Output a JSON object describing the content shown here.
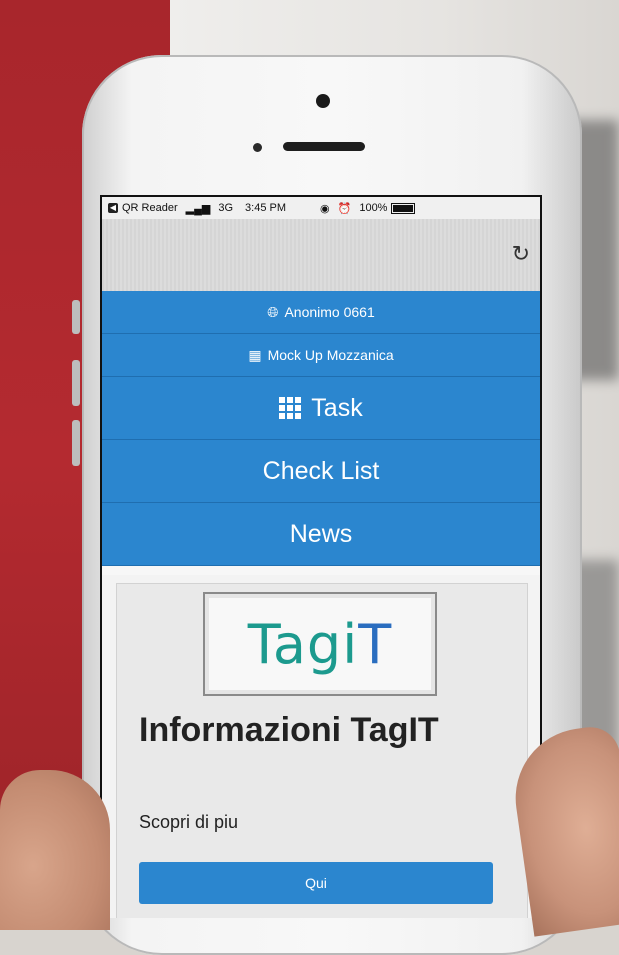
{
  "status_bar": {
    "app": "QR Reader",
    "network": "3G",
    "time": "3:45 PM",
    "battery": "100%"
  },
  "menu": {
    "user": "Anonimo 0661",
    "project": "Mock Up Mozzanica",
    "items": [
      "Task",
      "Check List",
      "News"
    ]
  },
  "card": {
    "logo_main": "Tagi",
    "logo_accent": "T",
    "title": "Informazioni TagIT",
    "subtitle": "Scopri di piu",
    "button": "Qui"
  },
  "colors": {
    "accent": "#2b86cf",
    "logo_teal": "#1c9a8e"
  }
}
